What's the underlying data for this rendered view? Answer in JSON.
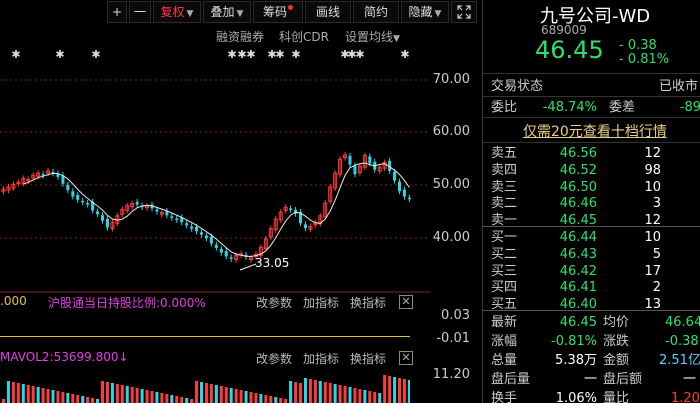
{
  "toolbar": {
    "plus": "+",
    "minus": "一",
    "fuquan": "复权",
    "diejia": "叠加",
    "chouma": "筹码",
    "huaxian": "画线",
    "jianyue": "简约",
    "yincang": "隐藏",
    "expand_icon": "expand-icon"
  },
  "subbar": {
    "rzrq": "融资融券",
    "kcdr": "科创CDR",
    "setma": "设置均线"
  },
  "chart": {
    "yticks": [
      "70.00",
      "60.00",
      "50.00",
      "40.00"
    ],
    "low_label": "33.05",
    "colors": {
      "up": "#ff3b3b",
      "down": "#26d9e6",
      "ma": "#e8e8e8",
      "grid": "#8a1e1e"
    }
  },
  "indicator1": {
    "label_left": ".000",
    "label_main": "沪股通当日持股比例:0.000%",
    "ticks": [
      "0.03",
      "-0.01"
    ],
    "modify": "改参数",
    "add": "加指标",
    "switch": "换指标",
    "close": "✕"
  },
  "indicator2": {
    "label": "MAVOL2:53699.800",
    "arrow": "↓",
    "tick": "11.20",
    "modify": "改参数",
    "add": "加指标",
    "switch": "换指标",
    "close": "✕"
  },
  "stock": {
    "name": "九号公司-WD",
    "code": "689009",
    "price": "46.45",
    "change": "- 0.38",
    "change_pct": "- 0.81%",
    "status_label": "交易状态",
    "status_value": "已收市",
    "weibi_label": "委比",
    "weibi_value": "-48.74%",
    "weicha_label": "委差",
    "weicha_value": "-89",
    "promo": "仅需20元查看十档行情"
  },
  "orderbook": {
    "asks": [
      {
        "label": "卖五",
        "price": "46.56",
        "vol": "12"
      },
      {
        "label": "卖四",
        "price": "46.52",
        "vol": "98"
      },
      {
        "label": "卖三",
        "price": "46.50",
        "vol": "10"
      },
      {
        "label": "卖二",
        "price": "46.46",
        "vol": "3"
      },
      {
        "label": "卖一",
        "price": "46.45",
        "vol": "12"
      }
    ],
    "bids": [
      {
        "label": "买一",
        "price": "46.44",
        "vol": "10"
      },
      {
        "label": "买二",
        "price": "46.43",
        "vol": "5"
      },
      {
        "label": "买三",
        "price": "46.42",
        "vol": "17"
      },
      {
        "label": "买四",
        "price": "46.41",
        "vol": "2"
      },
      {
        "label": "买五",
        "price": "46.40",
        "vol": "13"
      }
    ]
  },
  "stats": {
    "zuixin_label": "最新",
    "zuixin_value": "46.45",
    "junjia_label": "均价",
    "junjia_value": "46.64",
    "zhangfu_label": "涨幅",
    "zhangfu_value": "-0.81%",
    "zhangdie_label": "涨跌",
    "zhangdie_value": "-0.38",
    "zongliang_label": "总量",
    "zongliang_value": "5.38万",
    "jine_label": "金额",
    "jine_value": "2.51亿",
    "panhouliang_label": "盘后量",
    "panhouliang_value": "一",
    "panhoue_label": "盘后额",
    "panhoue_value": "一",
    "huanshou_label": "换手",
    "huanshou_value": "1.06%",
    "liangbi_label": "量比",
    "liangbi_value": "1.20"
  }
}
